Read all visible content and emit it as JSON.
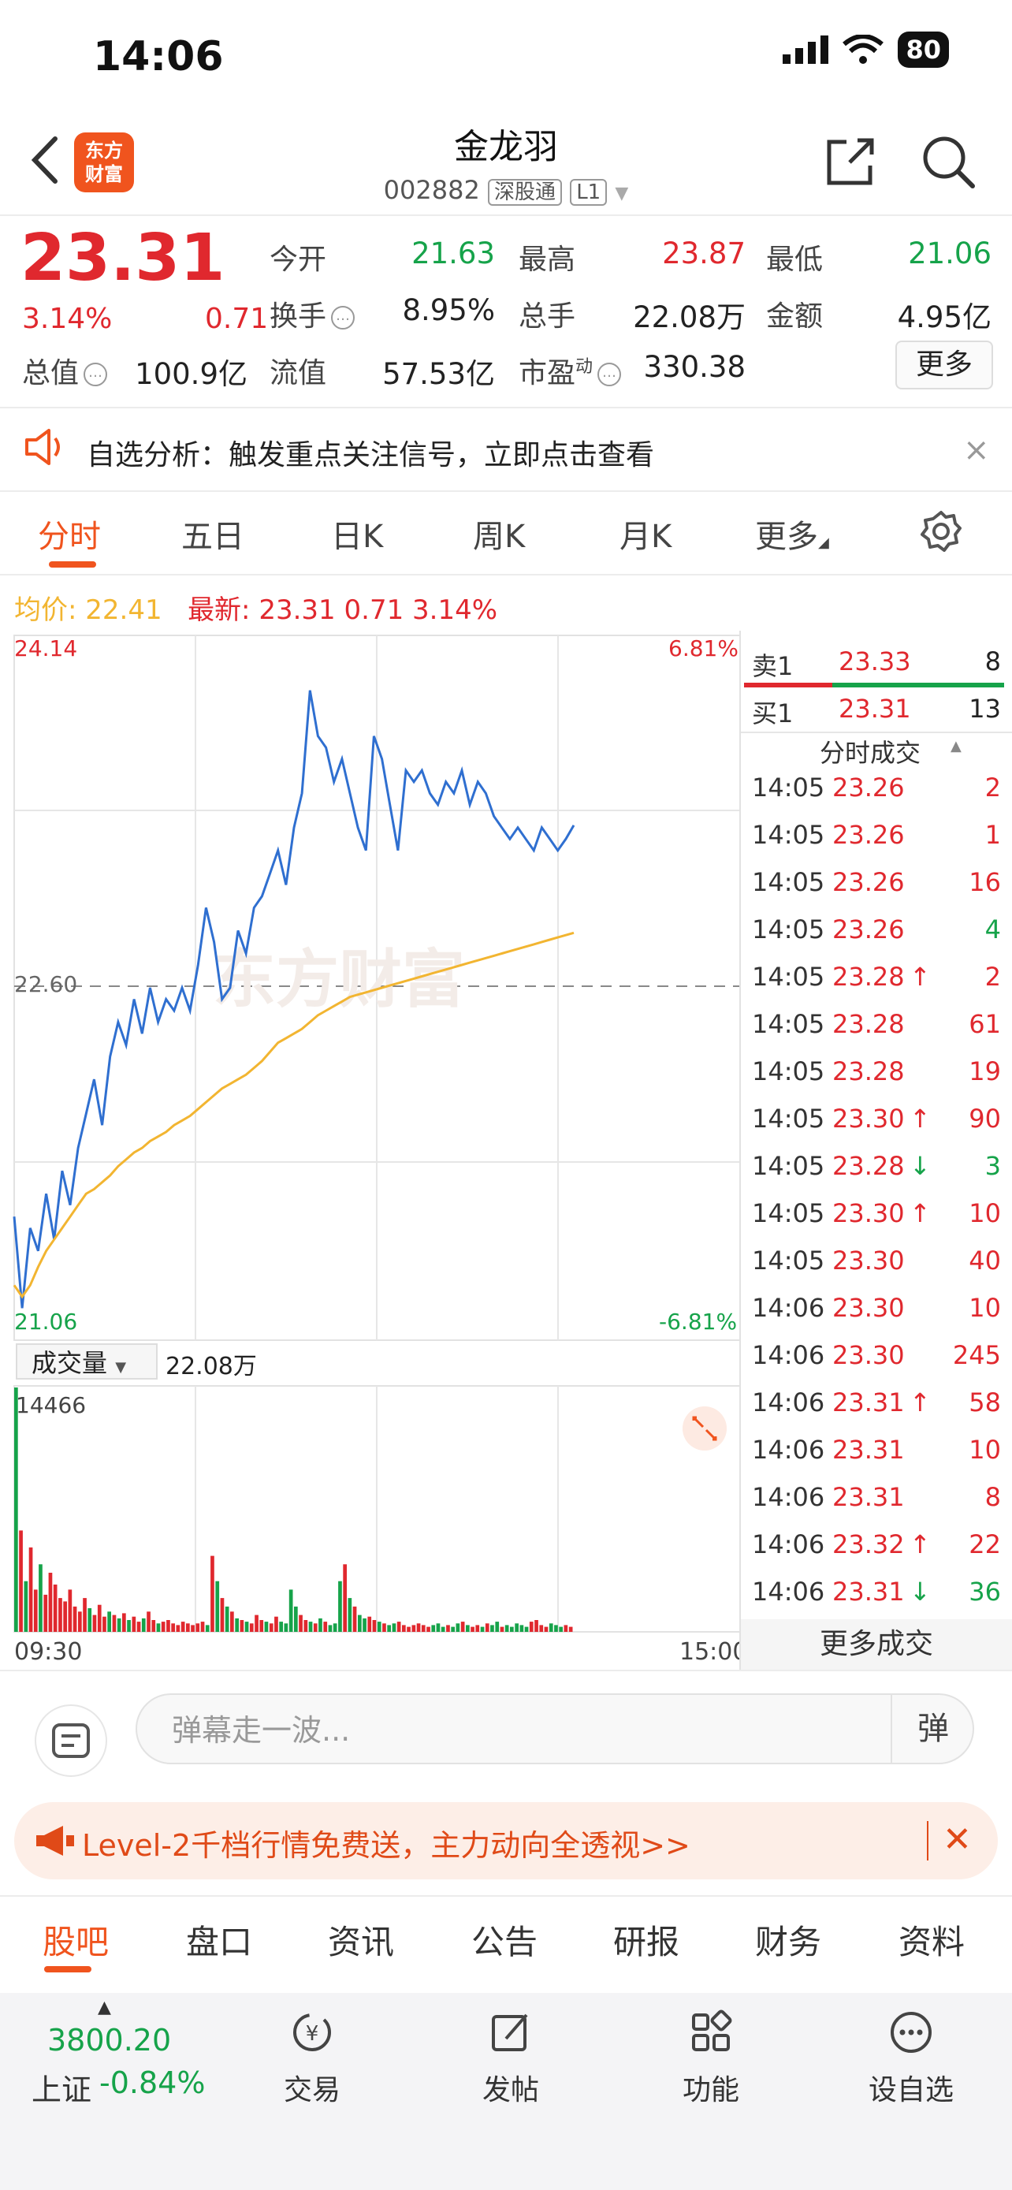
{
  "status": {
    "time": "14:06",
    "battery": "80"
  },
  "header": {
    "logo": "东方\n财富",
    "name": "金龙羽",
    "code": "002882",
    "market_tag": "深股通",
    "level_tag": "L1"
  },
  "quote": {
    "price": "23.31",
    "change_pct": "3.14%",
    "change": "0.71",
    "fields": [
      {
        "label": "今开",
        "value": "21.63"
      },
      {
        "label": "最高",
        "value": "23.87"
      },
      {
        "label": "最低",
        "value": "21.06"
      },
      {
        "label": "换手",
        "value": "8.95%"
      },
      {
        "label": "总手",
        "value": "22.08万"
      },
      {
        "label": "金额",
        "value": "4.95亿"
      },
      {
        "label": "总值",
        "value": "100.9亿"
      },
      {
        "label": "流值",
        "value": "57.53亿"
      },
      {
        "label": "市盈",
        "sup": "动",
        "value": "330.38"
      }
    ],
    "more_label": "更多"
  },
  "analysis": {
    "text": "自选分析：触发重点关注信号，立即点击查看",
    "close": "×"
  },
  "chart_tabs": [
    "分时",
    "五日",
    "日K",
    "周K",
    "月K",
    "更多"
  ],
  "legend": {
    "avg_label": "均价:",
    "avg_value": "22.41",
    "latest_label": "最新:",
    "latest_value": "23.31",
    "latest_change": "0.71",
    "latest_pct": "3.14%"
  },
  "chart_data": {
    "type": "line",
    "ylim": [
      21.06,
      24.14
    ],
    "y_high_label": "24.14",
    "y_low_label": "21.06",
    "y_mid_label": "22.60",
    "pct_high_label": "6.81%",
    "pct_low_label": "-6.81%",
    "x_start_label": "09:30",
    "x_end_label": "15:00",
    "watermark": "东方财富",
    "series": [
      {
        "values": [
          21.6,
          21.2,
          21.55,
          21.45,
          21.7,
          21.5,
          21.8,
          21.65,
          21.9,
          22.05,
          22.2,
          22.0,
          22.3,
          22.45,
          22.35,
          22.55,
          22.4,
          22.6,
          22.45,
          22.55,
          22.5,
          22.6,
          22.5,
          22.7,
          22.95,
          22.8,
          22.55,
          22.6,
          22.85,
          22.75,
          22.95,
          23.0,
          23.1,
          23.2,
          23.05,
          23.3,
          23.45,
          23.9,
          23.7,
          23.65,
          23.5,
          23.6,
          23.45,
          23.3,
          23.2,
          23.7,
          23.6,
          23.4,
          23.2,
          23.55,
          23.5,
          23.55,
          23.45,
          23.4,
          23.5,
          23.45,
          23.55,
          23.4,
          23.5,
          23.45,
          23.35,
          23.3,
          23.25,
          23.3,
          23.25,
          23.2,
          23.3,
          23.25,
          23.2,
          23.25,
          23.31
        ]
      },
      {
        "values": [
          21.3,
          21.25,
          21.3,
          21.38,
          21.45,
          21.5,
          21.55,
          21.6,
          21.65,
          21.7,
          21.72,
          21.75,
          21.78,
          21.82,
          21.85,
          21.88,
          21.9,
          21.93,
          21.95,
          21.97,
          22.0,
          22.02,
          22.04,
          22.07,
          22.1,
          22.13,
          22.16,
          22.18,
          22.2,
          22.22,
          22.25,
          22.28,
          22.32,
          22.36,
          22.38,
          22.4,
          22.42,
          22.45,
          22.48,
          22.5,
          22.52,
          22.54,
          22.56,
          22.57,
          22.58,
          22.59,
          22.6,
          22.61,
          22.62,
          22.63,
          22.64,
          22.65,
          22.66,
          22.67,
          22.68,
          22.69,
          22.7,
          22.71,
          22.72,
          22.73,
          22.74,
          22.75,
          22.76,
          22.77,
          22.78,
          22.79,
          22.8,
          22.81,
          22.82,
          22.83,
          22.84
        ]
      }
    ],
    "volume": {
      "selector_label": "成交量",
      "total_label": "22.08万",
      "max_label": "14466",
      "values": [
        14466,
        6000,
        3000,
        5000,
        2500,
        4000,
        2200,
        3500,
        2800,
        2000,
        1800,
        2500,
        1500,
        1200,
        2000,
        1400,
        1000,
        1600,
        900,
        1200,
        1000,
        800,
        1100,
        700,
        900,
        600,
        800,
        1200,
        700,
        500,
        600,
        700,
        500,
        400,
        600,
        500,
        400,
        500,
        600,
        400,
        4500,
        3000,
        2000,
        1500,
        1200,
        800,
        700,
        600,
        500,
        1000,
        700,
        600,
        500,
        900,
        600,
        500,
        2500,
        1500,
        1000,
        700,
        600,
        500,
        800,
        600,
        400,
        500,
        3000,
        4000,
        2000,
        1500,
        1000,
        800,
        900,
        700,
        600,
        500,
        400,
        500,
        600,
        400,
        300,
        400,
        500,
        400,
        300,
        400,
        500,
        300,
        400,
        300,
        500,
        600,
        400,
        300,
        400,
        300,
        500,
        400,
        600,
        300,
        400,
        300,
        500,
        400,
        300,
        600,
        700,
        400,
        300,
        500,
        400,
        300,
        400,
        300
      ]
    }
  },
  "order_book": {
    "ask": {
      "label": "卖1",
      "price": "23.33",
      "vol": "8"
    },
    "bid": {
      "label": "买1",
      "price": "23.31",
      "vol": "13"
    },
    "title": "分时成交",
    "ticks": [
      {
        "time": "14:05",
        "price": "23.26",
        "arrow": "",
        "vol": "2",
        "color": "red"
      },
      {
        "time": "14:05",
        "price": "23.26",
        "arrow": "",
        "vol": "1",
        "color": "red"
      },
      {
        "time": "14:05",
        "price": "23.26",
        "arrow": "",
        "vol": "16",
        "color": "red"
      },
      {
        "time": "14:05",
        "price": "23.26",
        "arrow": "",
        "vol": "4",
        "color": "green"
      },
      {
        "time": "14:05",
        "price": "23.28",
        "arrow": "↑",
        "vol": "2",
        "color": "red"
      },
      {
        "time": "14:05",
        "price": "23.28",
        "arrow": "",
        "vol": "61",
        "color": "red"
      },
      {
        "time": "14:05",
        "price": "23.28",
        "arrow": "",
        "vol": "19",
        "color": "red"
      },
      {
        "time": "14:05",
        "price": "23.30",
        "arrow": "↑",
        "vol": "90",
        "color": "red"
      },
      {
        "time": "14:05",
        "price": "23.28",
        "arrow": "↓",
        "vol": "3",
        "color": "green"
      },
      {
        "time": "14:05",
        "price": "23.30",
        "arrow": "↑",
        "vol": "10",
        "color": "red"
      },
      {
        "time": "14:05",
        "price": "23.30",
        "arrow": "",
        "vol": "40",
        "color": "red"
      },
      {
        "time": "14:06",
        "price": "23.30",
        "arrow": "",
        "vol": "10",
        "color": "red"
      },
      {
        "time": "14:06",
        "price": "23.30",
        "arrow": "",
        "vol": "245",
        "color": "red"
      },
      {
        "time": "14:06",
        "price": "23.31",
        "arrow": "↑",
        "vol": "58",
        "color": "red"
      },
      {
        "time": "14:06",
        "price": "23.31",
        "arrow": "",
        "vol": "10",
        "color": "red"
      },
      {
        "time": "14:06",
        "price": "23.31",
        "arrow": "",
        "vol": "8",
        "color": "red"
      },
      {
        "time": "14:06",
        "price": "23.32",
        "arrow": "↑",
        "vol": "22",
        "color": "red"
      },
      {
        "time": "14:06",
        "price": "23.31",
        "arrow": "↓",
        "vol": "36",
        "color": "green"
      }
    ],
    "more": "更多成交"
  },
  "danmu": {
    "placeholder": "弹幕走一波...",
    "button": "弹"
  },
  "promo": {
    "text": "Level-2千档行情免费送，主力动向全透视>>",
    "close": "✕"
  },
  "bottom_tabs": [
    "股吧",
    "盘口",
    "资讯",
    "公告",
    "研报",
    "财务",
    "资料"
  ],
  "toolbar": {
    "index_value": "3800.20",
    "index_name": "上证",
    "index_pct": "-0.84%",
    "tools": [
      "交易",
      "发帖",
      "功能",
      "设自选"
    ]
  },
  "colors": {
    "up": "#e0282e",
    "down": "#16a34a",
    "brand": "#f0541e",
    "price_line": "#2f6fd0",
    "avg_line": "#f2b531"
  }
}
